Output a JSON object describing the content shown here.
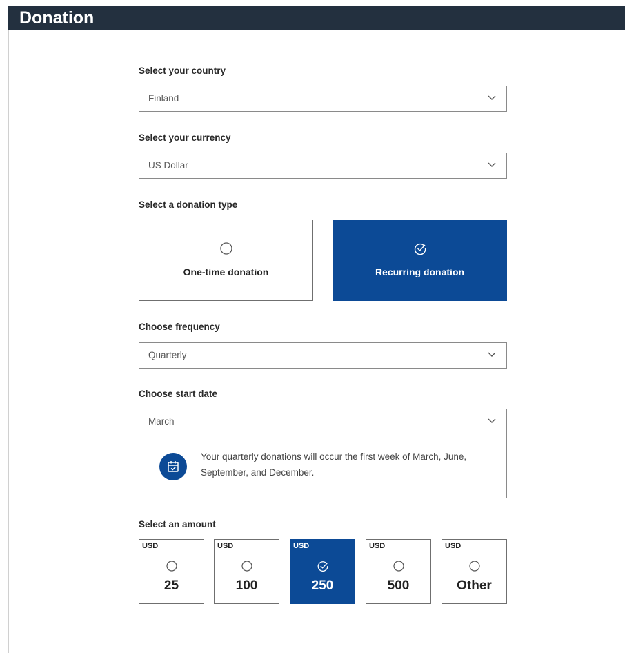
{
  "header": {
    "title": "Donation"
  },
  "country": {
    "label": "Select your country",
    "value": "Finland",
    "icon": "chevron-down-icon"
  },
  "currency": {
    "label": "Select your currency",
    "value": "US Dollar",
    "icon": "chevron-down-icon"
  },
  "donation_type": {
    "label": "Select a donation type",
    "options": [
      {
        "label": "One-time donation",
        "selected": false,
        "icon": "radio-empty-icon"
      },
      {
        "label": "Recurring donation",
        "selected": true,
        "icon": "check-circle-icon"
      }
    ]
  },
  "frequency": {
    "label": "Choose frequency",
    "value": "Quarterly",
    "icon": "chevron-down-icon"
  },
  "start_date": {
    "label": "Choose start date",
    "value": "March",
    "icon": "chevron-down-icon",
    "info_icon": "calendar-check-icon",
    "info_text": "Your quarterly donations will occur the first week of March, June, September, and December."
  },
  "amount": {
    "label": "Select an amount",
    "options": [
      {
        "currency": "USD",
        "value": "25",
        "selected": false
      },
      {
        "currency": "USD",
        "value": "100",
        "selected": false
      },
      {
        "currency": "USD",
        "value": "250",
        "selected": true
      },
      {
        "currency": "USD",
        "value": "500",
        "selected": false
      },
      {
        "currency": "USD",
        "value": "Other",
        "selected": false
      }
    ]
  },
  "colors": {
    "header_bg": "#23303f",
    "accent": "#0c4a96",
    "border": "#8a8a8a"
  }
}
